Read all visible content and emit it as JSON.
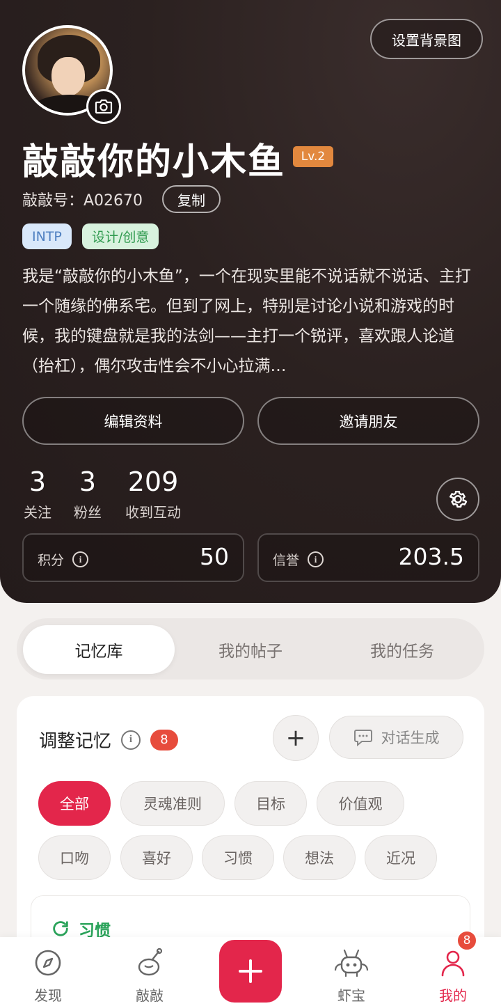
{
  "profile": {
    "background_button": "设置背景图",
    "nickname": "敲敲你的小木鱼",
    "level": "Lv.2",
    "id_text": "敲敲号：A02670",
    "copy_label": "复制",
    "tags": [
      "INTP",
      "设计/创意"
    ],
    "bio": "我是“敲敲你的小木鱼”，一个在现实里能不说话就不说话、主打一个随缘的佛系宅。但到了网上，特别是讨论小说和游戏的时候，我的键盘就是我的法剑——主打一个锐评，喜欢跟人论道（抬杠），偶尔攻击性会不小心拉满…",
    "edit_button": "编辑资料",
    "invite_button": "邀请朋友"
  },
  "stats": [
    {
      "value": "3",
      "label": "关注"
    },
    {
      "value": "3",
      "label": "粉丝"
    },
    {
      "value": "209",
      "label": "收到互动"
    }
  ],
  "cards": {
    "points": {
      "label": "积分",
      "value": "50"
    },
    "credit": {
      "label": "信誉",
      "value": "203.5"
    }
  },
  "tabs": [
    "记忆库",
    "我的帖子",
    "我的任务"
  ],
  "memory": {
    "title": "调整记忆",
    "count": "8",
    "generate_label": "对话生成",
    "chips": [
      "全部",
      "灵魂准则",
      "目标",
      "价值观",
      "口吻",
      "喜好",
      "习惯",
      "想法",
      "近况"
    ],
    "section_label": "习惯"
  },
  "nav": {
    "discover": "发现",
    "knock": "敲敲",
    "shrimp": "虾宝",
    "mine": "我的",
    "mine_badge": "8"
  },
  "colors": {
    "accent": "#e3264b",
    "header_bg": "#2b2120",
    "level_badge": "#e2883e",
    "habit_green": "#2aa35a"
  }
}
